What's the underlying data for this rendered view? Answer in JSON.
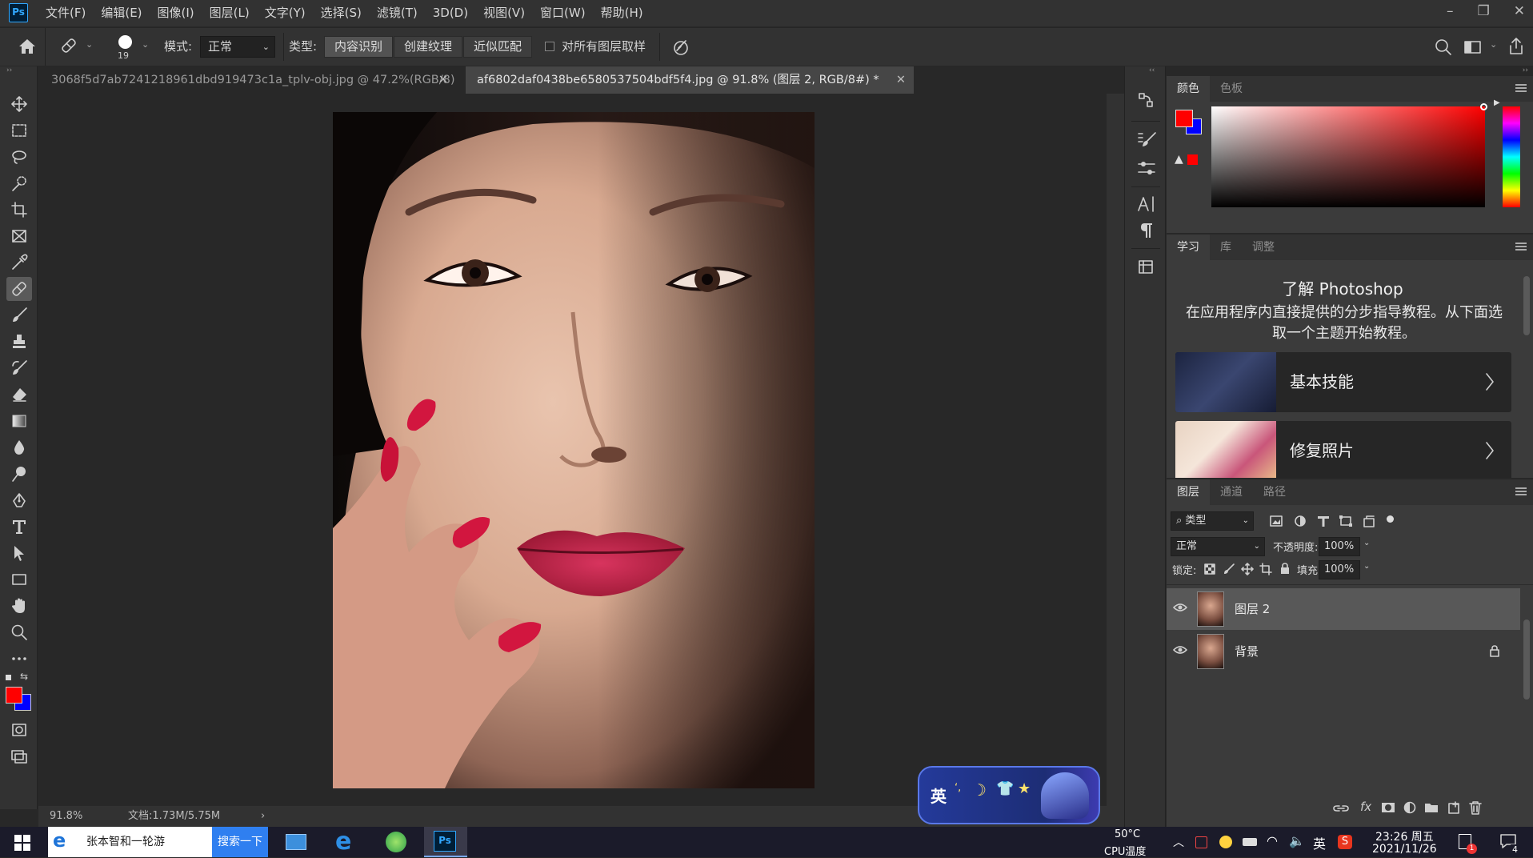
{
  "app": {
    "logo": "Ps",
    "accent": "#31a8ff"
  },
  "menubar": {
    "items": [
      "文件(F)",
      "编辑(E)",
      "图像(I)",
      "图层(L)",
      "文字(Y)",
      "选择(S)",
      "滤镜(T)",
      "3D(D)",
      "视图(V)",
      "窗口(W)",
      "帮助(H)"
    ],
    "window_controls": [
      "minimize-icon",
      "restore-icon",
      "close-icon"
    ]
  },
  "options_bar": {
    "brush_size": "19",
    "mode_label": "模式:",
    "mode_value": "正常",
    "type_label": "类型:",
    "type_buttons": [
      "内容识别",
      "创建纹理",
      "近似匹配"
    ],
    "active_type": "内容识别",
    "sample_all_label": "对所有图层取样",
    "sample_all_checked": false
  },
  "tabs": [
    {
      "title": "3068f5d7ab7241218961dbd919473c1a_tplv-obj.jpg @ 47.2%(RGB/8) *",
      "active": false
    },
    {
      "title": "af6802daf0438be6580537504bdf5f4.jpg  @ 91.8% (图层 2, RGB/8#) *",
      "active": true
    }
  ],
  "status": {
    "zoom": "91.8%",
    "doc": "文档:1.73M/5.75M"
  },
  "color_panel": {
    "tabs": [
      "颜色",
      "色板"
    ],
    "foreground": "#ff0000",
    "background": "#0000ff",
    "hue": "#ff0000"
  },
  "learn_panel": {
    "tabs": [
      "学习",
      "库",
      "调整"
    ],
    "title": "了解 Photoshop",
    "description": "在应用程序内直接提供的分步指导教程。从下面选取一个主题开始教程。",
    "cards": [
      "基本技能",
      "修复照片"
    ]
  },
  "layers_panel": {
    "tabs": [
      "图层",
      "通道",
      "路径"
    ],
    "filter_label": "类型",
    "blend_mode": "正常",
    "opacity_label": "不透明度:",
    "opacity": "100%",
    "lock_label": "锁定:",
    "fill_label": "填充:",
    "fill": "100%",
    "layers": [
      {
        "name": "图层 2",
        "visible": true,
        "selected": true,
        "locked": false
      },
      {
        "name": "背景",
        "visible": true,
        "selected": false,
        "locked": true
      }
    ]
  },
  "ime_toolbar": {
    "mode": "英"
  },
  "taskbar": {
    "search_text": "张本智和一轮游",
    "search_button": "搜索一下",
    "apps": [
      "store-icon",
      "edge-icon",
      "browser-360-icon",
      "photoshop-icon"
    ],
    "photoshop_label": "Ps",
    "temp": "50°C",
    "temp_label": "CPU温度",
    "ime": "英",
    "time": "23:26 周五",
    "date": "2021/11/26",
    "notification_count": "4",
    "badge_count": "1"
  }
}
